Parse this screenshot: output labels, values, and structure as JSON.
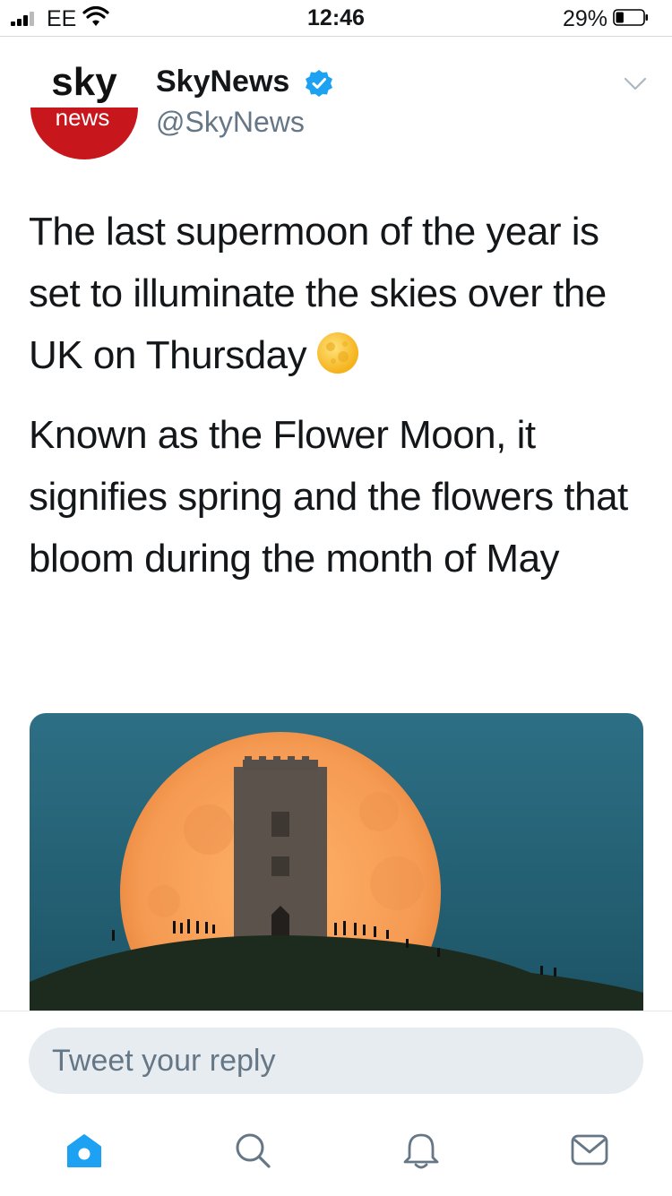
{
  "status_bar": {
    "carrier": "EE",
    "time": "12:46",
    "battery_percent": "29%",
    "battery_level": 0.29
  },
  "tweet": {
    "author": {
      "avatar_word_top": "sky",
      "avatar_word_bottom": "news",
      "name": "SkyNews",
      "handle": "@SkyNews",
      "verified": true
    },
    "paragraphs": [
      "The last supermoon of the year is set to illuminate the skies over the UK on Thursday",
      "Known as the Flower Moon, it signifies spring and the flowers that bloom during the month of May"
    ],
    "emoji": "full-moon-emoji",
    "image": "photo-supermoon-behind-tower-on-hill"
  },
  "reply": {
    "placeholder": "Tweet your reply"
  },
  "tab_bar": {
    "tabs": [
      "home-icon",
      "search-icon",
      "notifications-icon",
      "messages-icon"
    ],
    "active_color": "#1da1f2",
    "inactive_color": "#657786"
  }
}
